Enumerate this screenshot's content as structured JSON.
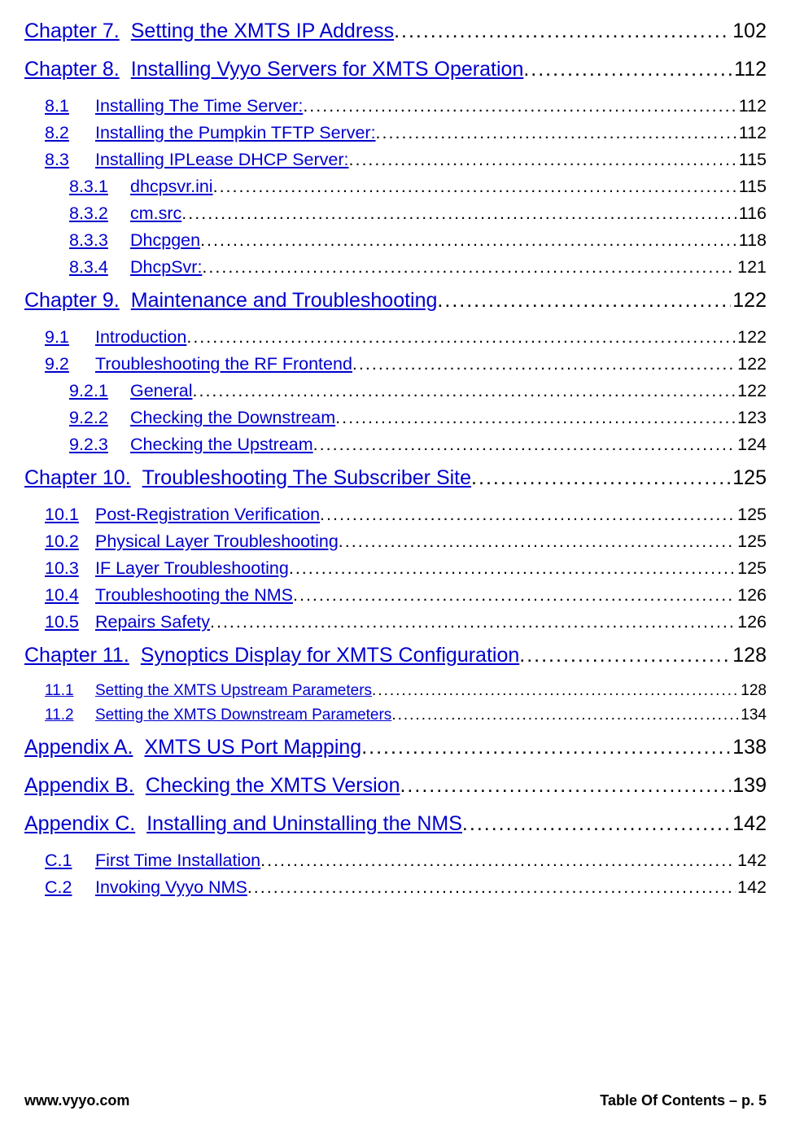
{
  "toc": [
    {
      "level": "level0",
      "num": "Chapter 7.",
      "gap": "  ",
      "title": "Setting the XMTS IP Address",
      "page": "102"
    },
    {
      "level": "level0",
      "num": "Chapter 8.",
      "gap": "  ",
      "title": "Installing Vyyo Servers for XMTS Operation",
      "page": "112"
    },
    {
      "level": "level1",
      "num": "8.1",
      "title": "Installing The Time Server:",
      "page": "112"
    },
    {
      "level": "level1",
      "num": "8.2",
      "title": "Installing the Pumpkin TFTP Server:",
      "page": "112"
    },
    {
      "level": "level1",
      "num": "8.3",
      "title": "Installing IPLease DHCP Server:",
      "page": "115"
    },
    {
      "level": "level2",
      "num": "8.3.1",
      "title": "dhcpsvr.ini",
      "page": "115"
    },
    {
      "level": "level2",
      "num": "8.3.2",
      "title": "cm.src",
      "page": "116"
    },
    {
      "level": "level2",
      "num": "8.3.3",
      "title": "Dhcpgen",
      "page": "118"
    },
    {
      "level": "level2",
      "num": "8.3.4",
      "title": "DhcpSvr:",
      "page": "121"
    },
    {
      "level": "level0",
      "num": "Chapter 9.",
      "gap": "  ",
      "title": "Maintenance and Troubleshooting",
      "page": "122"
    },
    {
      "level": "level1",
      "num": "9.1",
      "title": "Introduction",
      "page": "122"
    },
    {
      "level": "level1",
      "num": "9.2",
      "title": "Troubleshooting the RF Frontend",
      "page": "122"
    },
    {
      "level": "level2",
      "num": "9.2.1",
      "title": "General",
      "page": "122"
    },
    {
      "level": "level2",
      "num": "9.2.2",
      "title": "Checking the Downstream",
      "page": "123"
    },
    {
      "level": "level2",
      "num": "9.2.3",
      "title": "Checking the Upstream",
      "page": "124"
    },
    {
      "level": "level0",
      "num": "Chapter 10.",
      "gap": "    ",
      "title": "Troubleshooting The Subscriber Site",
      "page": "125"
    },
    {
      "level": "level1",
      "num": "10.1",
      "title": "Post-Registration Verification",
      "page": "125"
    },
    {
      "level": "level1",
      "num": "10.2",
      "title": "Physical Layer Troubleshooting",
      "page": "125"
    },
    {
      "level": "level1",
      "num": "10.3",
      "title": "IF Layer Troubleshooting",
      "page": "125"
    },
    {
      "level": "level1",
      "num": "10.4",
      "title": "Troubleshooting the NMS",
      "page": "126"
    },
    {
      "level": "level1",
      "num": "10.5",
      "title": "Repairs Safety",
      "page": "126"
    },
    {
      "level": "level0",
      "num": "Chapter 11.",
      "gap": "    ",
      "title": "Synoptics Display for XMTS Configuration",
      "page": "128"
    },
    {
      "level": "level1b",
      "num": "11.1",
      "title": "Setting the XMTS Upstream Parameters",
      "page": "128"
    },
    {
      "level": "level1b",
      "num": "11.2",
      "title": "Setting the XMTS Downstream Parameters",
      "page": "134"
    },
    {
      "level": "level0",
      "num": "Appendix A.",
      "gap": "    ",
      "title": "XMTS US Port Mapping",
      "page": "138"
    },
    {
      "level": "level0",
      "num": "Appendix B.",
      "gap": "    ",
      "title": "Checking the XMTS Version",
      "page": "139"
    },
    {
      "level": "level0",
      "num": "Appendix C.",
      "gap": "    ",
      "title": "Installing and Uninstalling the NMS",
      "page": "142"
    },
    {
      "level": "level1",
      "num": "C.1",
      "title": "First Time Installation",
      "page": "142"
    },
    {
      "level": "level1",
      "num": "C.2",
      "title": "Invoking Vyyo NMS",
      "page": "142"
    }
  ],
  "footer": {
    "left": "www.vyyo.com",
    "right": "Table Of Contents – p. 5"
  }
}
